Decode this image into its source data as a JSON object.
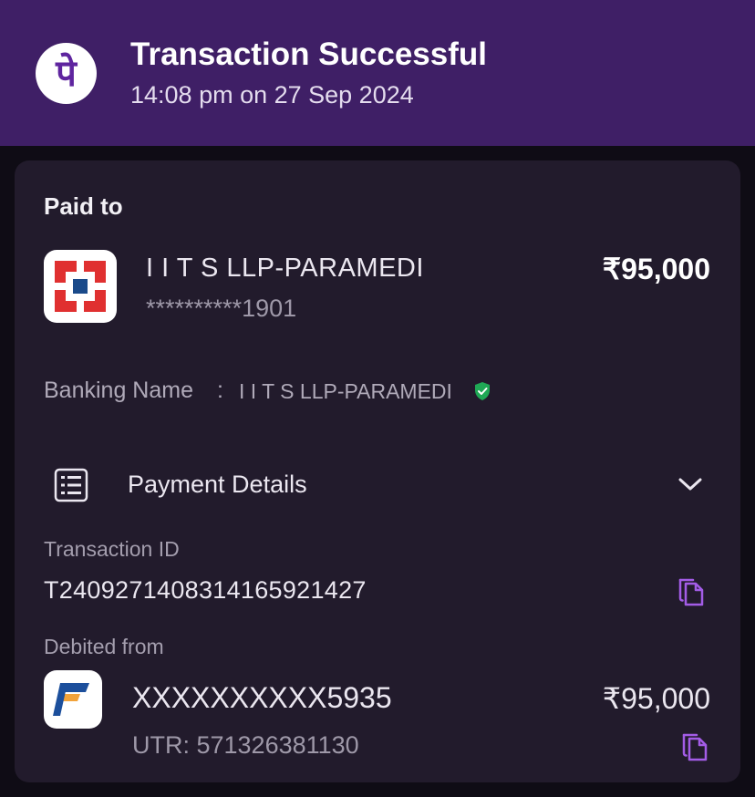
{
  "header": {
    "app_logo_glyph": "पे",
    "title": "Transaction Successful",
    "timestamp": "14:08 pm on 27 Sep 2024",
    "background_color": "#3f1f66"
  },
  "payee": {
    "section_label": "Paid to",
    "bank_icon": "hdfc-bank-logo-icon",
    "name": "I I T S LLP-PARAMEDI",
    "account": "**********1901",
    "amount": "₹95,000",
    "banking_name_label": "Banking Name",
    "banking_name_separator": ":",
    "banking_name_value": "I I T S LLP-PARAMEDI",
    "verified_icon": "verified-shield-icon"
  },
  "payment_details": {
    "label": "Payment Details",
    "icon": "receipt-list-icon",
    "toggle_icon": "chevron-down-icon",
    "transaction_id_label": "Transaction ID",
    "transaction_id": "T2409271408314165921427",
    "debited_from_label": "Debited from",
    "debit_bank_icon": "federal-bank-logo-icon",
    "debit_account": "XXXXXXXXXX5935",
    "debit_amount": "₹95,000",
    "utr": "UTR: 571326381130"
  },
  "colors": {
    "accent": "#a35ce6",
    "verified": "#1fa855",
    "card": "#221b2c"
  }
}
